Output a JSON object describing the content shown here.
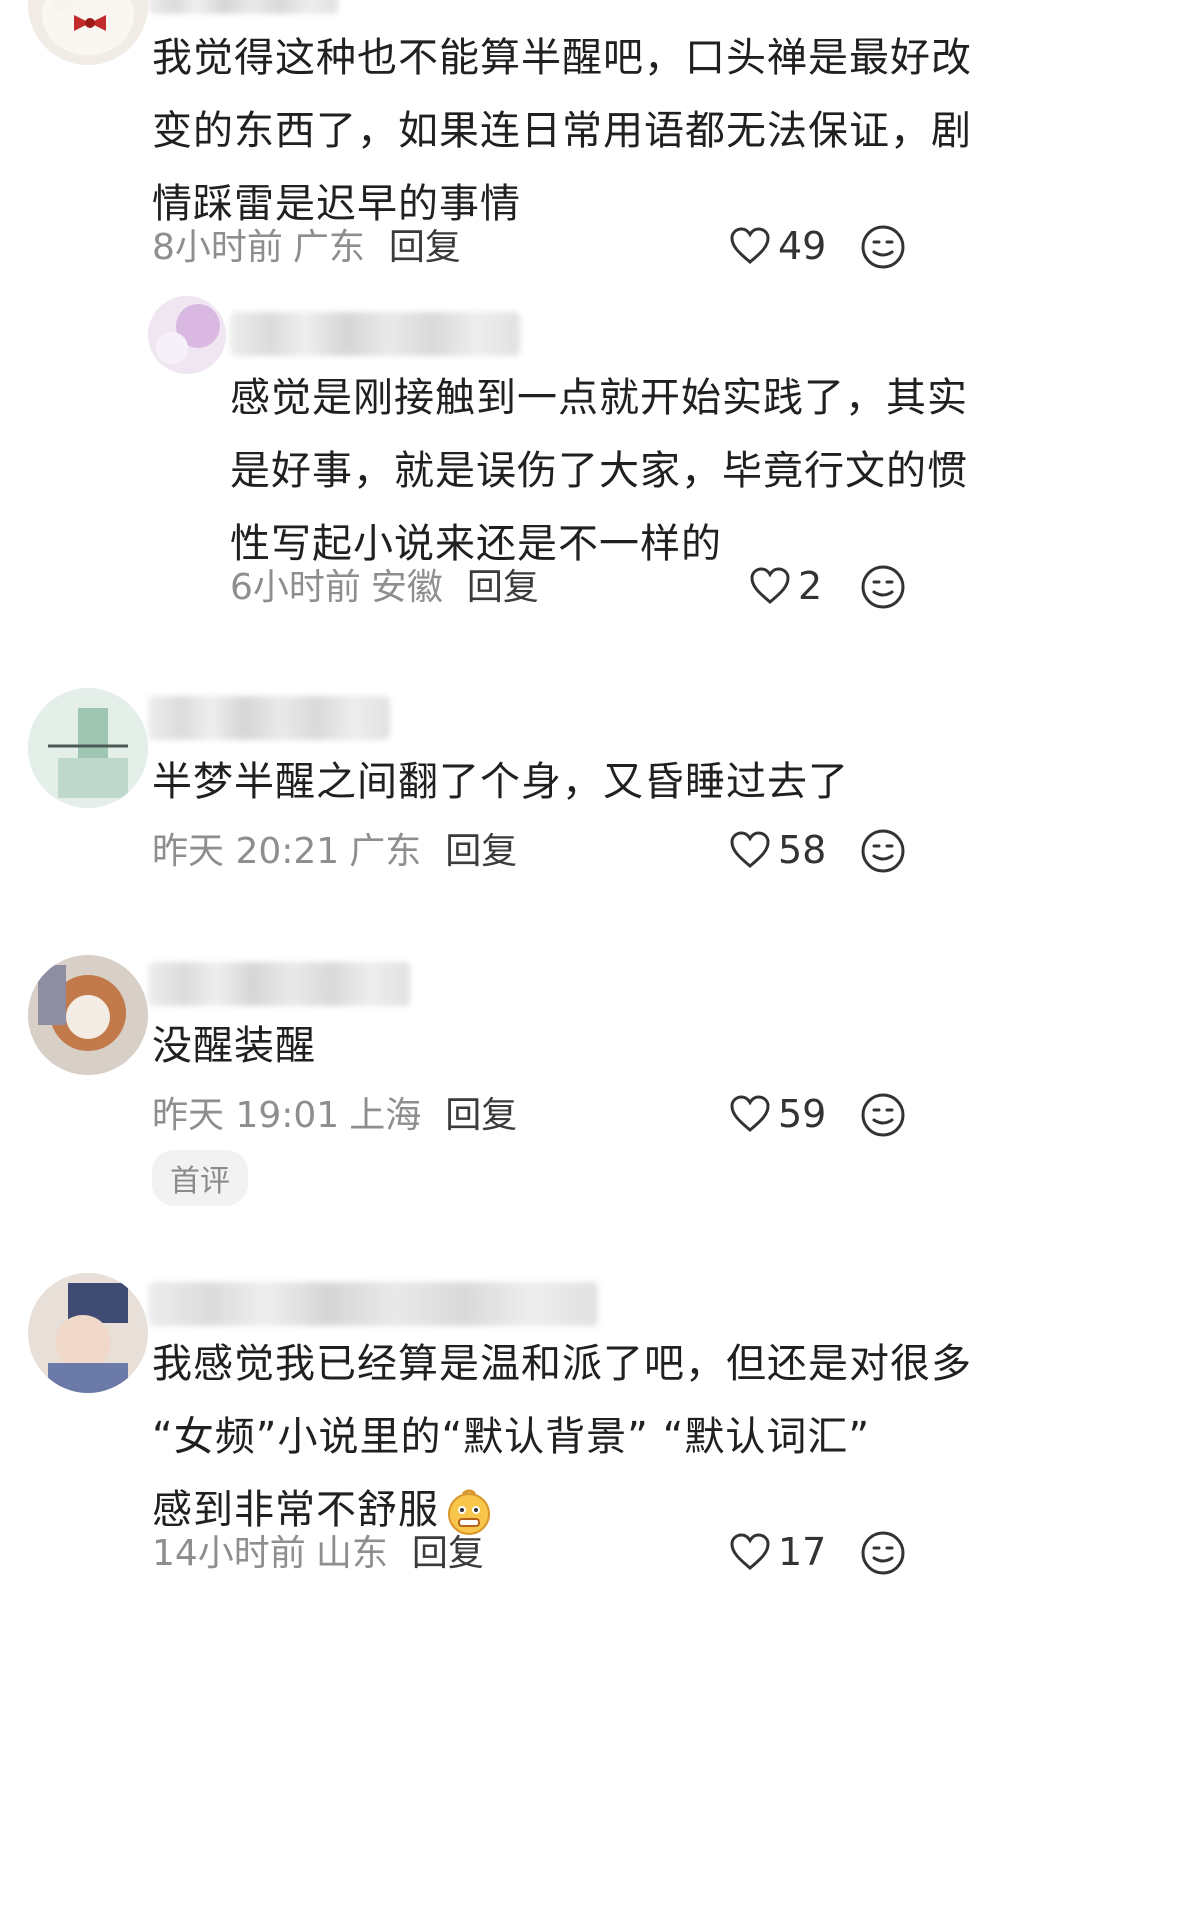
{
  "comments": [
    {
      "text_lines": [
        "我觉得这种也不能算半醒吧，口头禅是最好改",
        "变的东西了，如果连日常用语都无法保证，剧",
        "情踩雷是迟早的事情"
      ],
      "time": "8小时前",
      "location": "广东",
      "reply_label": "回复",
      "likes": "49"
    },
    {
      "text_lines": [
        "感觉是刚接触到一点就开始实践了，其实",
        "是好事，就是误伤了大家，毕竟行文的惯",
        "性写起小说来还是不一样的"
      ],
      "time": "6小时前",
      "location": "安徽",
      "reply_label": "回复",
      "likes": "2"
    },
    {
      "text_lines": [
        "半梦半醒之间翻了个身，又昏睡过去了"
      ],
      "time": "昨天 20:21",
      "location": "广东",
      "reply_label": "回复",
      "likes": "58"
    },
    {
      "text_lines": [
        "没醒装醒"
      ],
      "time": "昨天 19:01",
      "location": "上海",
      "reply_label": "回复",
      "likes": "59",
      "badge": "首评"
    },
    {
      "text_lines": [
        "我感觉我已经算是温和派了吧，但还是对很多",
        "“女频”小说里的“默认背景” “默认词汇”",
        "感到非常不舒服"
      ],
      "time": "14小时前",
      "location": "山东",
      "reply_label": "回复",
      "likes": "17"
    }
  ],
  "icons": {
    "like": "heart-outline-icon",
    "emoji": "smiley-face-icon",
    "inline_emoji": "grimace-emoji-icon"
  },
  "colors": {
    "text": "#202020",
    "meta": "#8e8e8e",
    "reply": "#3b3b3b",
    "badge_bg": "#f2f2f2"
  }
}
